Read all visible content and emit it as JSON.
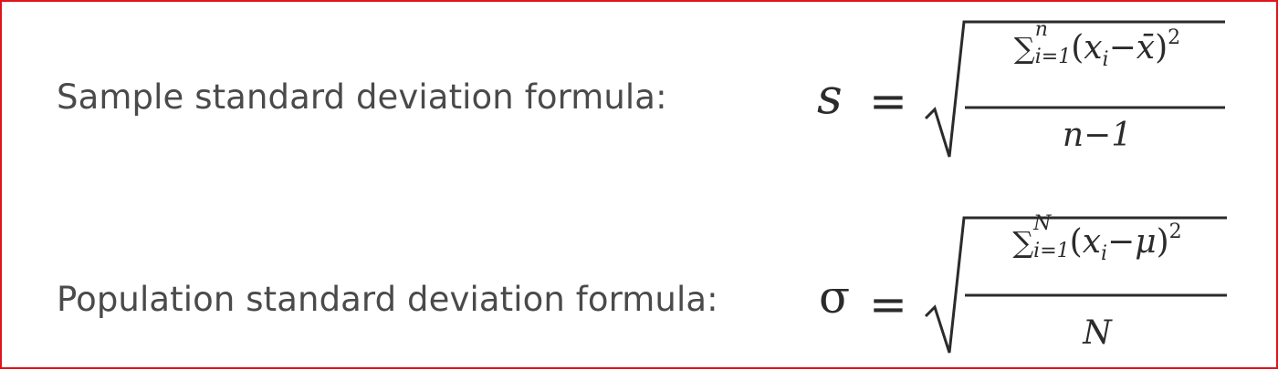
{
  "sample": {
    "label": "Sample standard deviation formula:",
    "variable": "s",
    "equals": "=",
    "sum_symbol": "∑",
    "upper_limit": "n",
    "lower_limit": "i=1",
    "open_paren": "(",
    "x": "x",
    "subscript_i": "i",
    "minus": "−",
    "mean": "x̄",
    "close_paren": ")",
    "exponent": "2",
    "denominator": "n−1"
  },
  "population": {
    "label": "Population standard deviation formula:",
    "variable": "σ",
    "equals": "=",
    "sum_symbol": "∑",
    "upper_limit": "N",
    "lower_limit": "i=1",
    "open_paren": "(",
    "x": "x",
    "subscript_i": "i",
    "minus": "−",
    "mean": "μ",
    "close_paren": ")",
    "exponent": "2",
    "denominator": "N"
  },
  "colors": {
    "border": "#e0141c",
    "label_text": "#4a4a4a",
    "math_text": "#2b2b2b"
  }
}
